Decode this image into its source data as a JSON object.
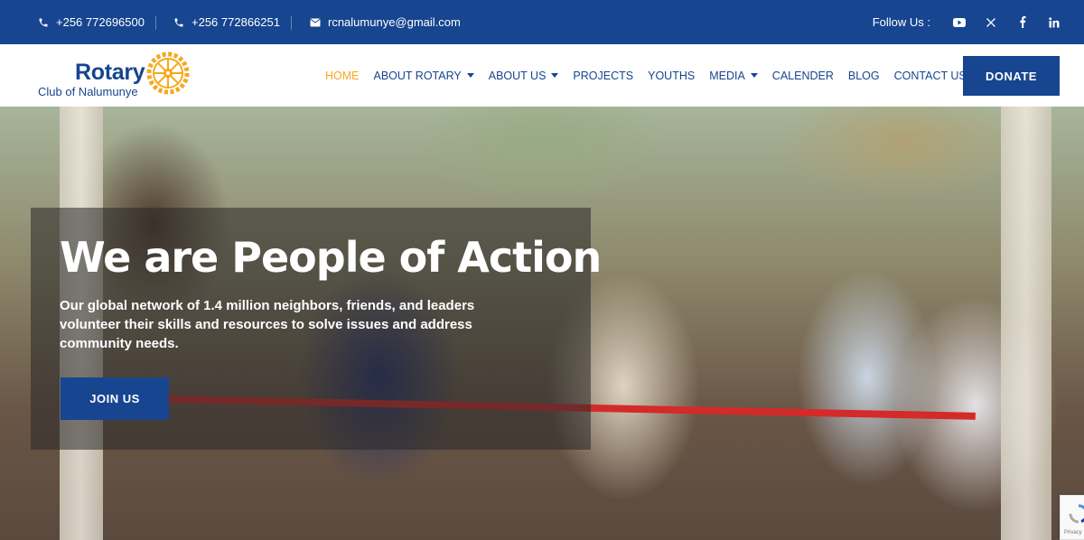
{
  "topbar": {
    "phone1": "+256 772696500",
    "phone2": "+256 772866251",
    "email": "rcnalumunye@gmail.com",
    "follow_label": "Follow Us :",
    "socials": [
      "youtube-icon",
      "x-icon",
      "facebook-icon",
      "linkedin-icon"
    ]
  },
  "logo": {
    "name": "Rotary",
    "subtitle": "Club of Nalumunye"
  },
  "nav": {
    "items": [
      {
        "label": "HOME",
        "active": true,
        "dropdown": false
      },
      {
        "label": "ABOUT ROTARY",
        "active": false,
        "dropdown": true
      },
      {
        "label": "ABOUT US",
        "active": false,
        "dropdown": true
      },
      {
        "label": "PROJECTS",
        "active": false,
        "dropdown": false
      },
      {
        "label": "YOUTHS",
        "active": false,
        "dropdown": false
      },
      {
        "label": "MEDIA",
        "active": false,
        "dropdown": true
      },
      {
        "label": "CALENDER",
        "active": false,
        "dropdown": false
      },
      {
        "label": "BLOG",
        "active": false,
        "dropdown": false
      },
      {
        "label": "CONTACT US",
        "active": false,
        "dropdown": false
      }
    ],
    "donate_label": "DONATE"
  },
  "hero": {
    "title": "We are People of Action",
    "text": "Our global network of 1.4 million neighbors, friends, and leaders volunteer their skills and resources to solve issues and address community needs.",
    "button_label": "JOIN US"
  },
  "recaptcha": {
    "label": "Privacy"
  },
  "colors": {
    "primary": "#17458f",
    "accent": "#f7a81b",
    "white": "#ffffff"
  }
}
